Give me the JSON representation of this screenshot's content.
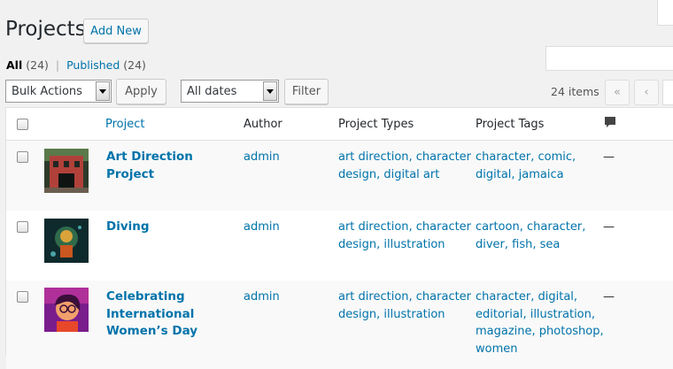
{
  "page": {
    "title": "Projects",
    "add_new_label": "Add New"
  },
  "subsubsub": {
    "all_label": "All",
    "all_count": "(24)",
    "separator": "|",
    "published_label": "Published",
    "published_count": "(24)"
  },
  "tablenav": {
    "bulk_actions_value": "Bulk Actions",
    "apply_label": "Apply",
    "dates_value": "All dates",
    "filter_label": "Filter",
    "items_count": "24 items",
    "first_page_glyph": "«",
    "prev_page_glyph": "‹"
  },
  "columns": {
    "project": "Project",
    "author": "Author",
    "types": "Project Types",
    "tags": "Project Tags",
    "comments_icon": "comment-bubble-icon"
  },
  "rows": [
    {
      "title": "Art Direction Project",
      "author": "admin",
      "types_line1": "art direction, character",
      "types_line2": "design, digital art",
      "tags_line1": "character, comic,",
      "tags_line2": "digital, jamaica",
      "comments": "—",
      "thumb_icon": "building-thumbnail"
    },
    {
      "title": "Diving",
      "author": "admin",
      "types_line1": "art direction, character",
      "types_line2": "design, illustration",
      "tags_line1": "cartoon, character,",
      "tags_line2": "diver, fish, sea",
      "comments": "—",
      "thumb_icon": "diver-thumbnail"
    },
    {
      "title_line1": "Celebrating",
      "title_line2": "International",
      "title_line3": "Women’s Day",
      "author": "admin",
      "types_line1": "art direction, character",
      "types_line2": "design, illustration",
      "tags_line1": "character, digital,",
      "tags_line2": "editorial, illustration,",
      "tags_line3": "magazine, photoshop,",
      "tags_line4": "women",
      "comments": "—",
      "thumb_icon": "woman-portrait-thumbnail"
    }
  ],
  "colors": {
    "link": "#0073aa",
    "background": "#f1f1f1",
    "row_alt": "#f9f9f9"
  }
}
